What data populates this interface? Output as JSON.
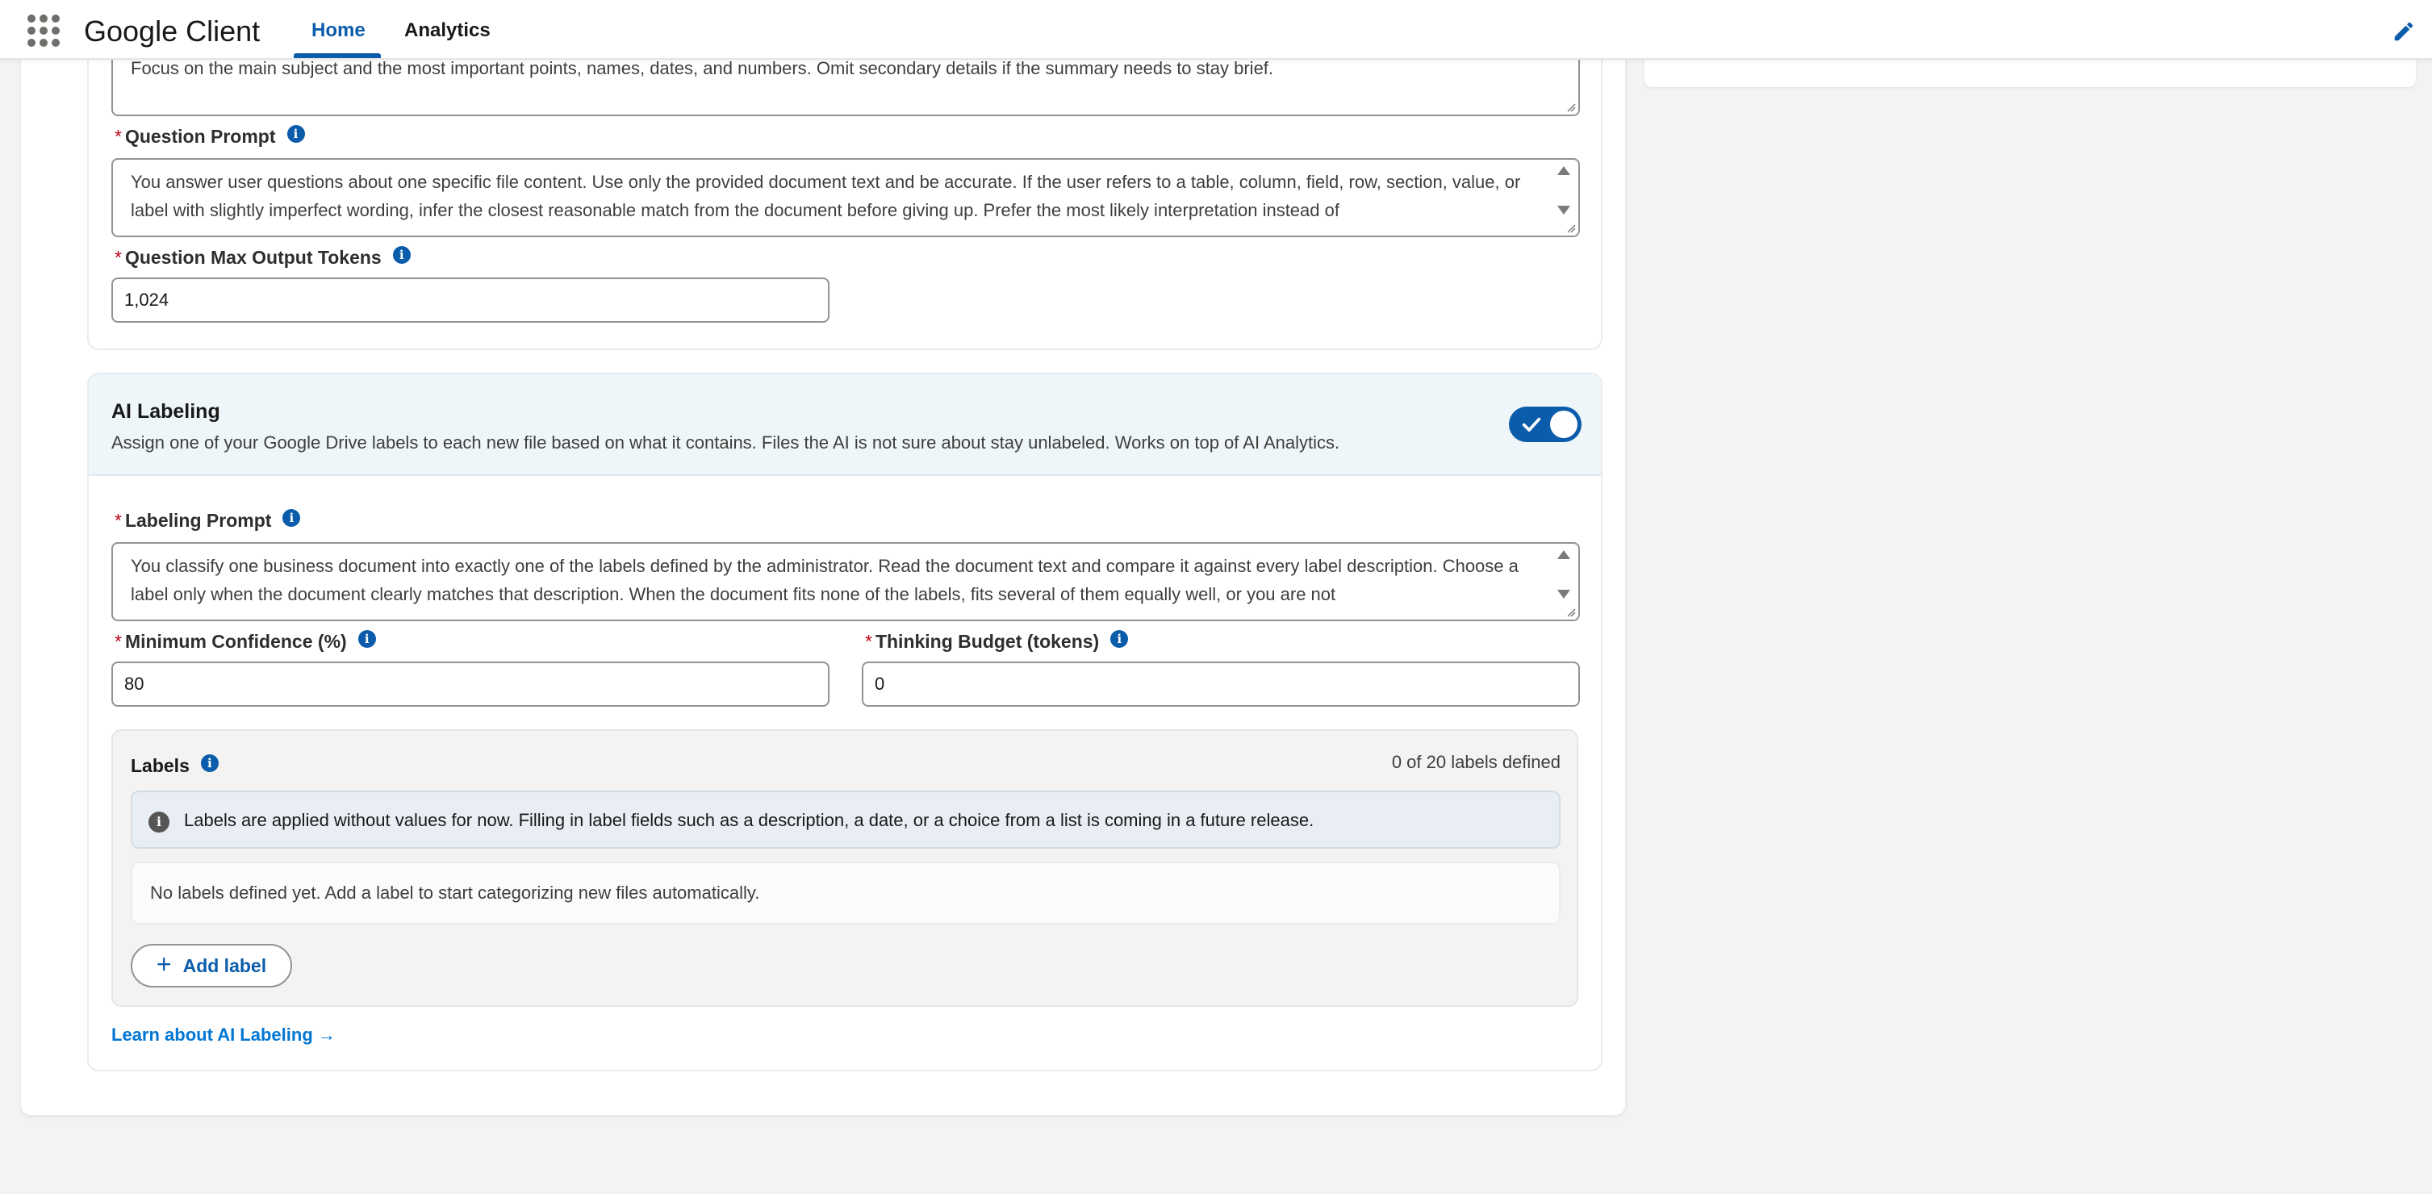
{
  "header": {
    "app_name": "Google Client",
    "tabs": [
      {
        "label": "Home",
        "active": true
      },
      {
        "label": "Analytics",
        "active": false
      }
    ],
    "icons": [
      "app-launcher-icon",
      "pencil-icon"
    ]
  },
  "summary_prompt": {
    "value": "Create a very short summary of the provided document content that starts with \"This file describes\". Use only the text provided in the document and keep the summary accurate. Focus on the main subject and the most important points, names, dates, and numbers. Omit secondary details if the summary needs to stay brief."
  },
  "question_prompt": {
    "label": "Question Prompt",
    "value": "You answer user questions about one specific file content. Use only the provided document text and be accurate. If the user refers to a table, column, field, row, section, value, or label with slightly imperfect wording, infer the closest reasonable match from the document before giving up. Prefer the most likely interpretation instead of"
  },
  "question_max_tokens": {
    "label": "Question Max Output Tokens",
    "value": "1,024"
  },
  "ai_labeling": {
    "title": "AI Labeling",
    "description": "Assign one of your Google Drive labels to each new file based on what it contains. Files the AI is not sure about stay unlabeled. Works on top of AI Analytics.",
    "enabled": true,
    "labeling_prompt": {
      "label": "Labeling Prompt",
      "value": "You classify one business document into exactly one of the labels defined by the administrator. Read the document text and compare it against every label description. Choose a label only when the document clearly matches that description. When the document fits none of the labels, fits several of them equally well, or you are not"
    },
    "min_confidence": {
      "label": "Minimum Confidence (%)",
      "value": "80"
    },
    "thinking_budget": {
      "label": "Thinking Budget (tokens)",
      "value": "0"
    },
    "labels": {
      "title": "Labels",
      "count_text": "0 of 20 labels defined",
      "notice": "Labels are applied without values for now. Filling in label fields such as a description, a date, or a choice from a list is coming in a future release.",
      "empty_text": "No labels defined yet. Add a label to start categorizing new files automatically.",
      "add_button": "Add label"
    },
    "learn_link": "Learn about AI Labeling →"
  },
  "colors": {
    "brand": "#0b5cab",
    "link": "#0176d3",
    "required": "#ba0517",
    "header_tint": "#eef6f9"
  }
}
